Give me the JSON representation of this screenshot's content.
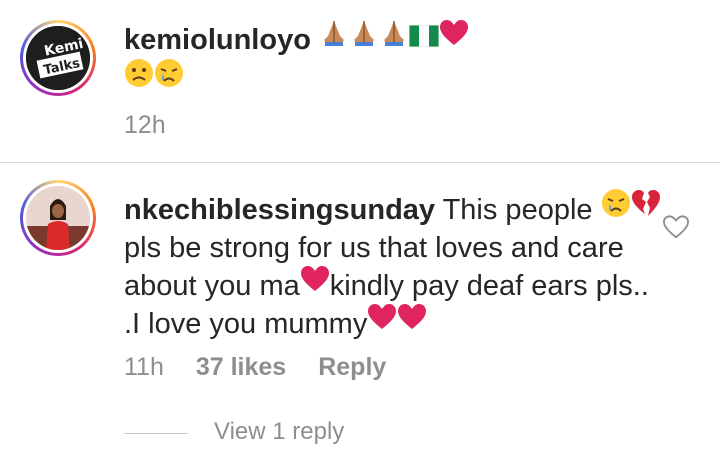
{
  "comments": [
    {
      "username": "kemiolunloyo",
      "avatar_text_top": "Kemi",
      "avatar_text_bottom": "Talks",
      "line1_emojis": [
        "folded-hands-icon",
        "folded-hands-icon",
        "folded-hands-icon",
        "nigeria-flag-icon",
        "red-heart-icon"
      ],
      "line2_emojis": [
        "frowning-face-icon",
        "crying-face-icon"
      ],
      "time": "12h"
    },
    {
      "username": "nkechiblessingsunday",
      "text_line1": "This people",
      "text_line2": "pls be strong for us that loves and care",
      "text_line3_a": "about you ma",
      "text_line3_b": "kindly pay deaf ears pls..",
      "text_line4": ".I love you mummy",
      "time": "11h",
      "likes": "37 likes",
      "reply_label": "Reply",
      "view_replies": "View 1 reply"
    }
  ],
  "colors": {
    "text": "#262626",
    "meta": "#8e8e8e",
    "heart": "#e0245e",
    "divider": "#dbdbdb"
  }
}
